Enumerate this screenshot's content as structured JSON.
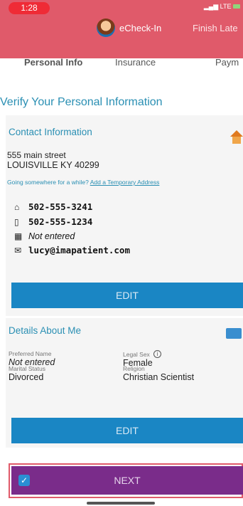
{
  "status_bar": {
    "time": "1:28",
    "signal": "LTE"
  },
  "header": {
    "title": "eCheck-In",
    "action": "Finish Late"
  },
  "tabs": [
    {
      "label": "Personal Info"
    },
    {
      "label": "Insurance"
    },
    {
      "label": "Paym"
    }
  ],
  "page_title": "Verify Your Personal Information",
  "contact": {
    "title": "Contact Information",
    "address_line1": "555 main street",
    "address_line2": "LOUISVILLE KY 40299",
    "temp_prompt": "Going somewhere for a while?",
    "temp_link": "Add a Temporary Address",
    "home_phone": "502-555-3241",
    "mobile_phone": "502-555-1234",
    "work_phone": "Not entered",
    "email": "lucy@imapatient.com",
    "edit_label": "EDIT"
  },
  "details": {
    "title": "Details About Me",
    "preferred_name_label": "Preferred Name",
    "preferred_name": "Not entered",
    "legal_sex_label": "Legal Sex",
    "legal_sex": "Female",
    "marital_status_label": "Marital Status",
    "marital_status": "Divorced",
    "religion_label": "Religion",
    "religion": "Christian Scientist",
    "edit_label": "EDIT"
  },
  "next_label": "NEXT",
  "icons": {
    "home": "home-icon",
    "mobile": "mobile-phone-icon",
    "work": "office-building-icon",
    "email": "envelope-icon",
    "info": "info-icon",
    "check": "checkbox-icon"
  },
  "colors": {
    "header_bg": "#e05a6a",
    "accent_blue": "#2a8fb3",
    "edit_button": "#1a86c4",
    "next_button": "#7a2c8a"
  }
}
